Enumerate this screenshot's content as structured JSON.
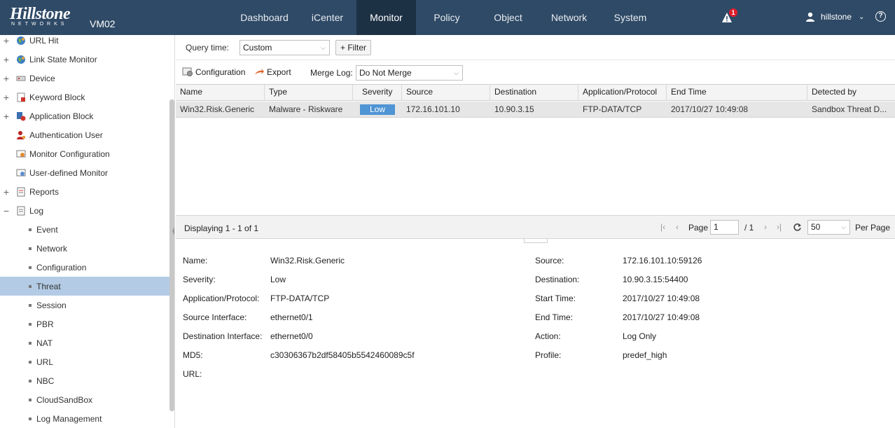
{
  "header": {
    "brand": "Hillstone",
    "brand_sub": "NETWORKS",
    "device": "VM02",
    "nav": [
      "Dashboard",
      "iCenter",
      "Monitor",
      "Policy",
      "Object",
      "Network",
      "System"
    ],
    "active_nav": "Monitor",
    "alert_count": "1",
    "user": "hillstone",
    "help": "?"
  },
  "sidebar": {
    "items": [
      {
        "label": "URL Hit",
        "toggle": "+",
        "icon": "globe-icon"
      },
      {
        "label": "Link State Monitor",
        "toggle": "+",
        "icon": "globe-icon"
      },
      {
        "label": "Device",
        "toggle": "+",
        "icon": "device-icon"
      },
      {
        "label": "Keyword Block",
        "toggle": "+",
        "icon": "keyword-icon"
      },
      {
        "label": "Application Block",
        "toggle": "+",
        "icon": "app-block-icon"
      },
      {
        "label": "Authentication User",
        "toggle": "",
        "icon": "auth-user-icon"
      },
      {
        "label": "Monitor Configuration",
        "toggle": "",
        "icon": "monitor-config-icon"
      },
      {
        "label": "User-defined Monitor",
        "toggle": "",
        "icon": "user-monitor-icon"
      },
      {
        "label": "Reports",
        "toggle": "+",
        "icon": "report-icon"
      },
      {
        "label": "Log",
        "toggle": "−",
        "icon": "log-icon"
      }
    ],
    "log_children": [
      "Event",
      "Network",
      "Configuration",
      "Threat",
      "Session",
      "PBR",
      "NAT",
      "URL",
      "NBC",
      "CloudSandBox",
      "Log Management"
    ],
    "selected": "Threat"
  },
  "toolbar": {
    "query_time_label": "Query time:",
    "query_time_value": "Custom",
    "filter_button": "+ Filter",
    "configuration": "Configuration",
    "export": "Export",
    "merge_log_label": "Merge Log:",
    "merge_log_value": "Do Not Merge"
  },
  "grid": {
    "columns": [
      "Name",
      "Type",
      "Severity",
      "Source",
      "Destination",
      "Application/Protocol",
      "End Time",
      "Detected by"
    ],
    "rows": [
      {
        "name": "Win32.Risk.Generic",
        "type": "Malware - Riskware",
        "severity": "Low",
        "source": "172.16.101.10",
        "destination": "10.90.3.15",
        "app": "FTP-DATA/TCP",
        "end_time": "2017/10/27 10:49:08",
        "detected_by": "Sandbox Threat D..."
      }
    ],
    "severity_color": "#4f94d4"
  },
  "pager": {
    "displaying": "Displaying 1 - 1 of 1",
    "page_label": "Page",
    "page_value": "1",
    "total": "/ 1",
    "per_page_value": "50",
    "per_page_label": "Per Page"
  },
  "details": {
    "left": [
      {
        "label": "Name:",
        "value": "Win32.Risk.Generic"
      },
      {
        "label": "Severity:",
        "value": "Low"
      },
      {
        "label": "Application/Protocol:",
        "value": "FTP-DATA/TCP"
      },
      {
        "label": "Source Interface:",
        "value": "ethernet0/1"
      },
      {
        "label": "Destination Interface:",
        "value": "ethernet0/0"
      },
      {
        "label": "MD5:",
        "value": "c30306367b2df58405b5542460089c5f"
      },
      {
        "label": "URL:",
        "value": ""
      }
    ],
    "right": [
      {
        "label": "Source:",
        "value": "172.16.101.10:59126"
      },
      {
        "label": "Destination:",
        "value": "10.90.3.15:54400"
      },
      {
        "label": "Start Time:",
        "value": "2017/10/27 10:49:08"
      },
      {
        "label": "End Time:",
        "value": "2017/10/27 10:49:08"
      },
      {
        "label": "Action:",
        "value": "Log Only"
      },
      {
        "label": "Profile:",
        "value": "predef_high"
      }
    ]
  },
  "colors": {
    "topbar": "#2f4a66",
    "active_nav": "#1d3145",
    "selected_row": "#b3cbe5"
  }
}
